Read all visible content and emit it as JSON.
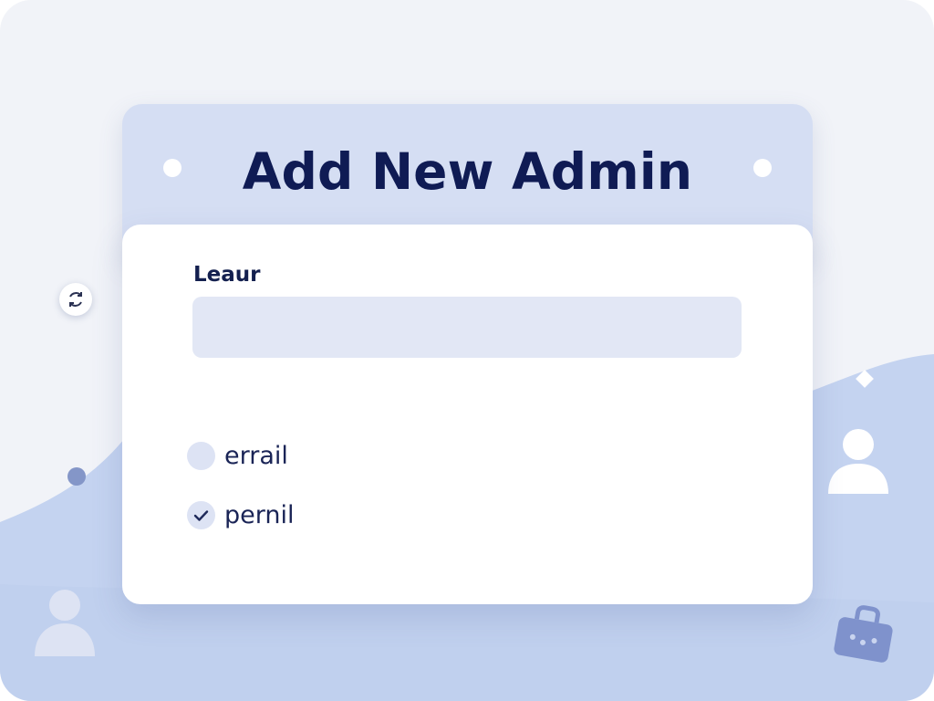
{
  "dialog": {
    "title": "Add New Admin",
    "field_label": "Leaur",
    "field_value": "",
    "options": [
      {
        "label": "errail",
        "checked": false
      },
      {
        "label": "pernil",
        "checked": true
      }
    ]
  },
  "icons": {
    "floating_button": "refresh-icon",
    "right_avatar": "user-icon",
    "left_avatar": "user-icon",
    "briefcase": "briefcase-icon"
  },
  "colors": {
    "title": "#0f1b54",
    "header_bg": "#d5def3",
    "input_bg": "#e2e7f5",
    "wave": "#c4d3f0",
    "accent": "#7f92cc"
  }
}
